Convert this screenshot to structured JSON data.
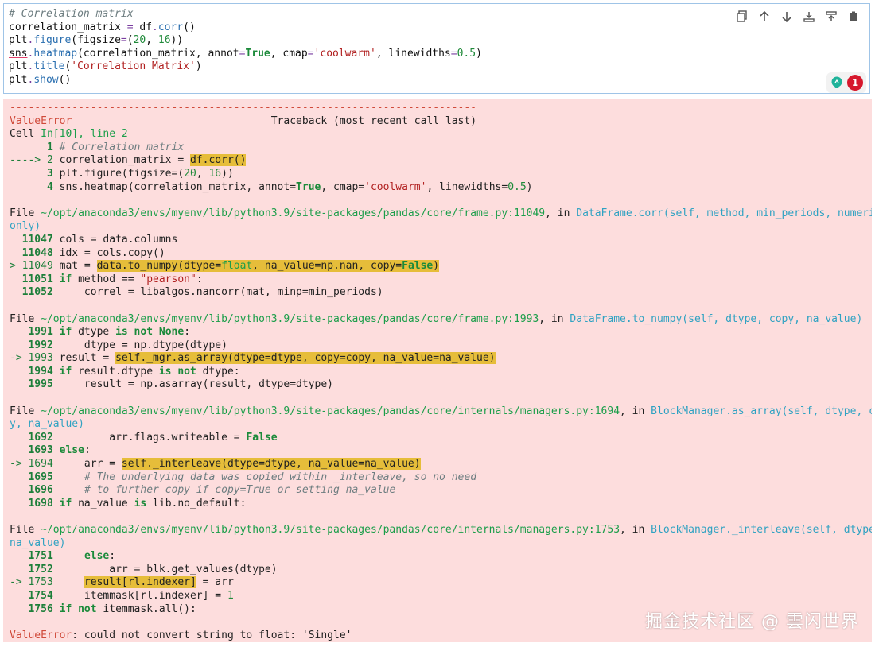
{
  "cell": {
    "lines": [
      "# Correlation matrix",
      "correlation_matrix = df.corr()",
      "plt.figure(figsize=(20, 16))",
      "sns.heatmap(correlation_matrix, annot=True, cmap='coolwarm', linewidths=0.5)",
      "plt.title('Correlation Matrix')",
      "plt.show()"
    ],
    "badge_count": "1",
    "toolbar_icons": [
      "duplicate-icon",
      "move-up-icon",
      "move-down-icon",
      "insert-below-icon",
      "insert-above-icon",
      "delete-icon"
    ]
  },
  "traceback": {
    "separator": "---------------------------------------------------------------------------",
    "error_type": "ValueError",
    "traceback_label": "Traceback (most recent call last)",
    "cell_ref_prefix": "Cell ",
    "cell_ref_link": "In[10], line 2",
    "frames": [
      {
        "file_prefix": "File ",
        "file_path": "~/opt/anaconda3/envs/myenv/lib/python3.9/site-packages/pandas/core/frame.py:11049",
        "in_word": ", in ",
        "func": "DataFrame.corr(self, method, min_periods, numeric_",
        "func_wrap": "only)"
      },
      {
        "file_prefix": "File ",
        "file_path": "~/opt/anaconda3/envs/myenv/lib/python3.9/site-packages/pandas/core/frame.py:1993",
        "in_word": ", in ",
        "func": "DataFrame.to_numpy(self, dtype, copy, na_value)"
      },
      {
        "file_prefix": "File ",
        "file_path": "~/opt/anaconda3/envs/myenv/lib/python3.9/site-packages/pandas/core/internals/managers.py:1694",
        "in_word": ", in ",
        "func": "BlockManager.as_array(self, dtype, cop",
        "func_wrap": "y, na_value)"
      },
      {
        "file_prefix": "File ",
        "file_path": "~/opt/anaconda3/envs/myenv/lib/python3.9/site-packages/pandas/core/internals/managers.py:1753",
        "in_word": ", in ",
        "func": "BlockManager._interleave(self, dtype,",
        "func_wrap": "na_value)"
      }
    ],
    "final_error_type": "ValueError",
    "final_error_msg": ": could not convert string to float: 'Single'"
  },
  "watermark": "掘金技术社区 @ 雲闪世界",
  "colors": {
    "error_bg": "#fddddd",
    "highlight": "#e6bd3a",
    "cell_border": "#9fc4e7",
    "badge": "#d6182d"
  }
}
